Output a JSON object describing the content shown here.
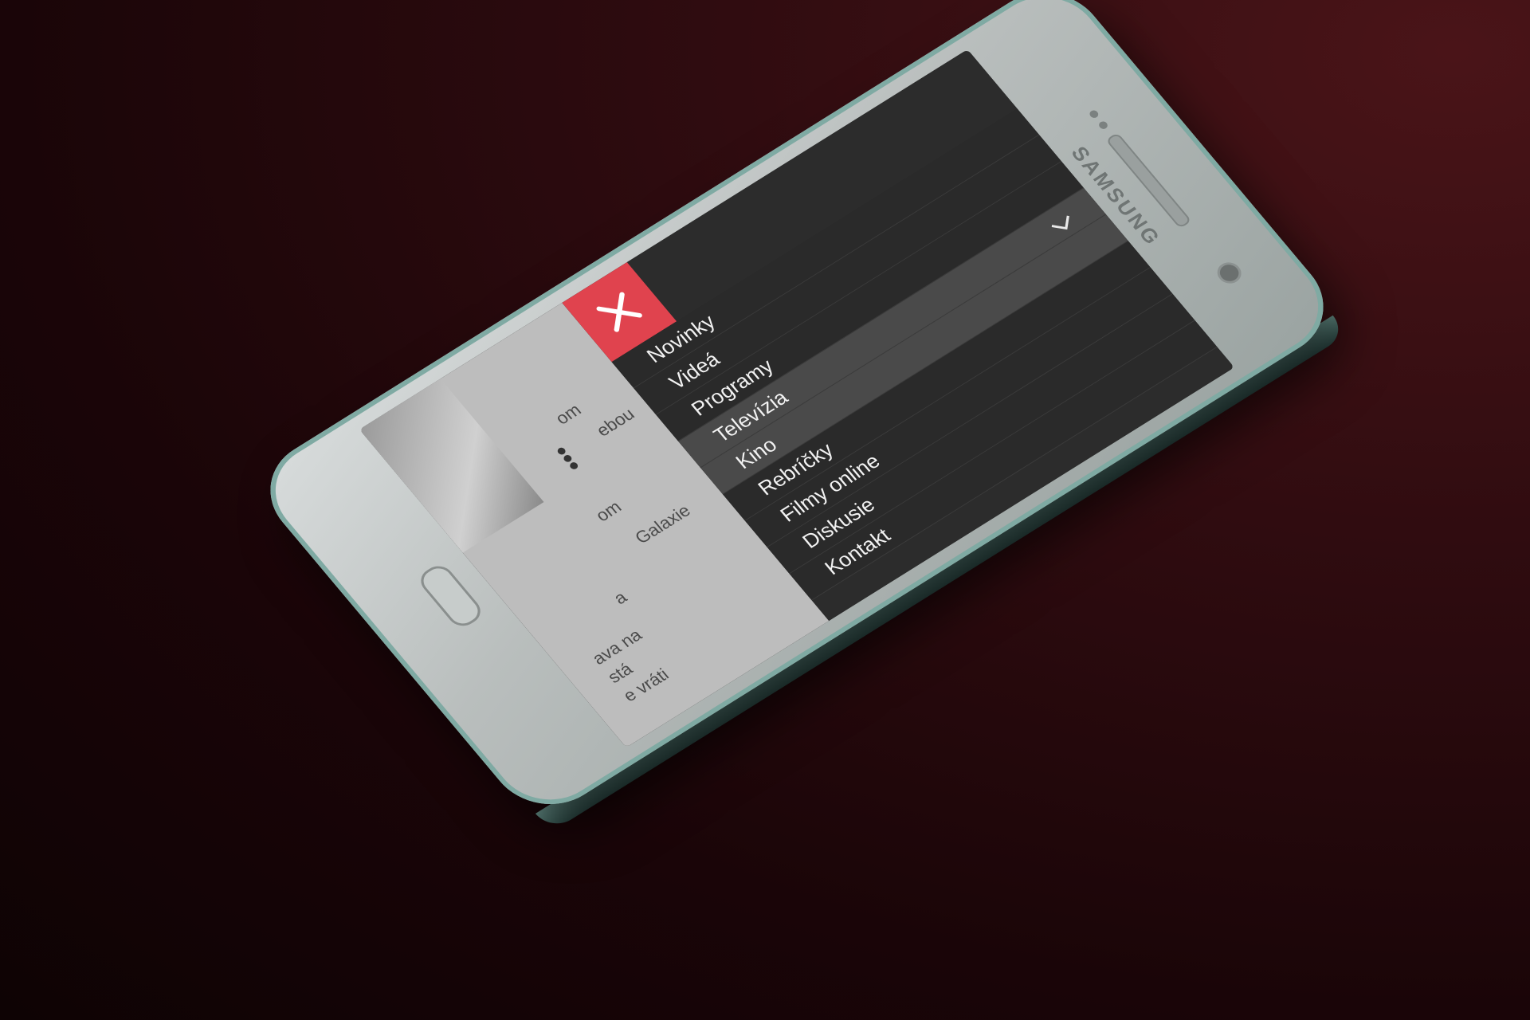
{
  "device": {
    "brand": "SAMSUNG"
  },
  "background_page": {
    "texts": [
      "om",
      "ebou",
      "om",
      "Galaxie",
      "a",
      "ava na",
      "stá",
      "e vráti"
    ],
    "more_icon": "more-vertical-icon"
  },
  "menu": {
    "close_icon": "close-icon",
    "close_color": "#e0434e",
    "items": [
      {
        "label": "Novinky",
        "active": false
      },
      {
        "label": "Videá",
        "active": false
      },
      {
        "label": "Programy",
        "active": false
      },
      {
        "label": "Televízia",
        "active": true
      },
      {
        "label": "Kino",
        "active": true
      },
      {
        "label": "Rebríčky",
        "active": false
      },
      {
        "label": "Filmy online",
        "active": false
      },
      {
        "label": "Diskusie",
        "active": false
      },
      {
        "label": "Kontakt",
        "active": false
      }
    ],
    "expand_icon": "chevron-down-icon"
  }
}
